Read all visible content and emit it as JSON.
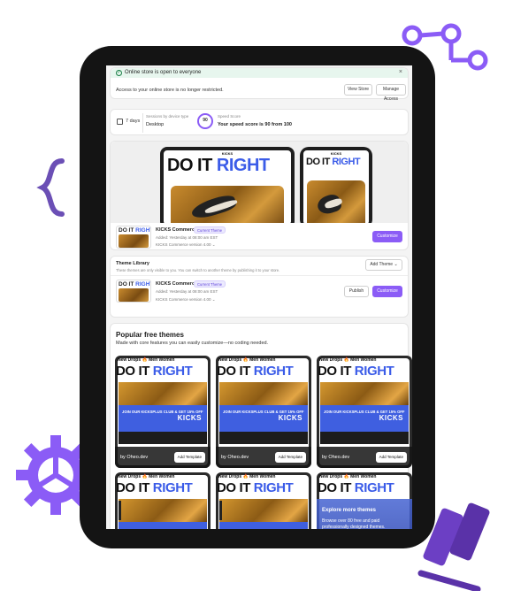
{
  "banner": {
    "title": "Online store is open to everyone",
    "message": "Access to your online store is no longer restricted.",
    "view_store": "View Store",
    "manage_access": "Manage Access"
  },
  "stats": {
    "days": "7 days",
    "sessions_label": "Sessions by device type",
    "sessions_value": "Desktop",
    "speed_label": "Speed Score",
    "speed_score": "90",
    "speed_value": "Your speed score is 90 from 100"
  },
  "current_theme": {
    "hero_word1": "DO IT",
    "hero_word2": "RIGHT",
    "mock_brand": "KICKS",
    "name": "KICKS Commerce",
    "badge": "Current Theme",
    "added": "Added: Yesterday at 08:00 am EST",
    "version": "KICKS Commerce version 4.00",
    "customize": "Customize"
  },
  "library": {
    "title": "Theme Library",
    "description": "These themes are only visible to you. You can switch to another theme by publishing it to your store.",
    "add_theme": "Add Theme",
    "name": "KICKS Commerce",
    "badge": "Current Theme",
    "added": "Added: Yesterday at 08:00 am EST",
    "version": "KICKS Commerce version 4.00",
    "publish": "Publish",
    "customize": "Customize"
  },
  "popular": {
    "title": "Popular free themes",
    "subtitle": "Made with core features you can easily customize—no coding needed.",
    "tile_nav": "New Drops 🔥  Men  Women",
    "tile_hero_1": "DO IT",
    "tile_hero_2": "RIGHT",
    "tile_promo": "JOIN OUR KICKSPLUS CLUB & GET 15% OFF",
    "tile_brand": "KICKS",
    "tile_by": "by Oheo.dev",
    "tile_add": "Add Template",
    "more_title": "Explore more themes",
    "more_desc": "Browse over 80 free and paid professionally designed themes."
  },
  "colors": {
    "accent": "#8b5cf6",
    "hero_blue": "#3b5ce8",
    "success": "#1a7f46"
  }
}
